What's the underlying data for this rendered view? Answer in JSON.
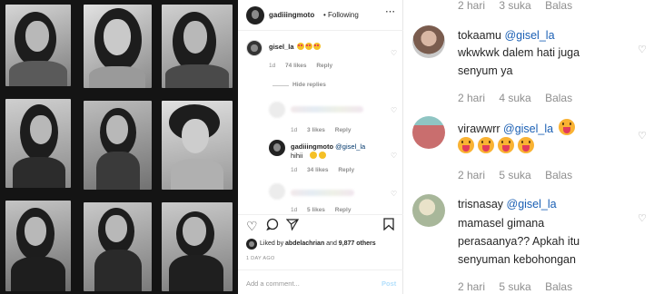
{
  "post": {
    "author": "gadiiingmoto",
    "follow_label": "• Following",
    "more_icon": "more-icon",
    "comments": [
      {
        "user": "gisel_la",
        "text_emojis": [
          "heart-eyes",
          "heart-eyes",
          "heart-eyes"
        ],
        "time": "1d",
        "likes": "74 likes",
        "reply": "Reply"
      }
    ],
    "hide_replies": "Hide replies",
    "replies": [
      {
        "blurred": true,
        "time": "1d",
        "likes": "3 likes",
        "reply": "Reply"
      },
      {
        "user": "gadiiingmoto",
        "mention": "@gisel_la",
        "text": "hihii",
        "time": "1d",
        "likes": "34 likes",
        "reply": "Reply"
      },
      {
        "blurred": true,
        "time": "1d",
        "likes": "5 likes",
        "reply": "Reply"
      }
    ],
    "liked_by_prefix": "Liked by ",
    "liked_by_user": "abdelachrian",
    "liked_by_and": " and ",
    "liked_by_others": "9,877 others",
    "time_ago": "1 DAY AGO",
    "add_comment_placeholder": "Add a comment...",
    "post_button": "Post"
  },
  "mobile": {
    "top_meta": {
      "time": "2 hari",
      "likes": "3 suka",
      "reply": "Balas"
    },
    "comments": [
      {
        "user": "tokaamu",
        "mention": "@gisel_la",
        "lines": [
          "wkwkwk dalem hati juga",
          "senyum ya"
        ],
        "time": "2 hari",
        "likes": "4 suka",
        "reply": "Balas"
      },
      {
        "user": "virawwrr",
        "mention": "@gisel_la",
        "lines": [],
        "time": "2 hari",
        "likes": "5 suka",
        "reply": "Balas"
      },
      {
        "user": "trisnasay",
        "mention": "@gisel_la",
        "lines": [
          "mamasel gimana",
          "perasaanya?? Apkah itu",
          "senyuman kebohongan"
        ],
        "time": "2 hari",
        "likes": "5 suka",
        "reply": "Balas"
      }
    ]
  }
}
